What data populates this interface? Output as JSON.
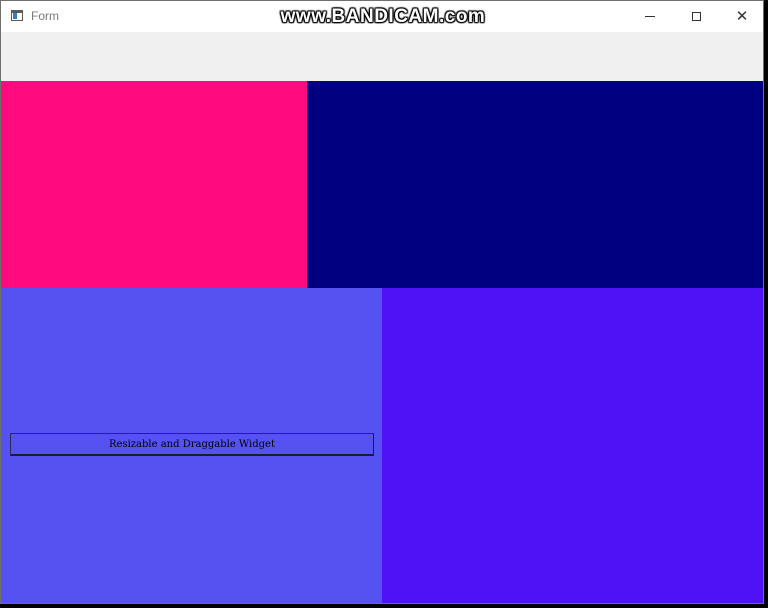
{
  "window": {
    "title": "Form",
    "icon": "app-window-icon",
    "watermark": "www.BANDICAM.com",
    "controls": {
      "minimize_icon": "minimize-icon",
      "maximize_icon": "maximize-icon",
      "close_icon": "close-icon",
      "close_glyph": "✕"
    }
  },
  "panels": [
    {
      "name": "top-left-panel",
      "color": "#ff0b7f"
    },
    {
      "name": "top-right-panel",
      "color": "#000080"
    },
    {
      "name": "bottom-left-panel",
      "color": "#5652f2"
    },
    {
      "name": "bottom-right-panel",
      "color": "#4f12f6"
    }
  ],
  "widget": {
    "label": "Resizable and Draggable Widget"
  }
}
